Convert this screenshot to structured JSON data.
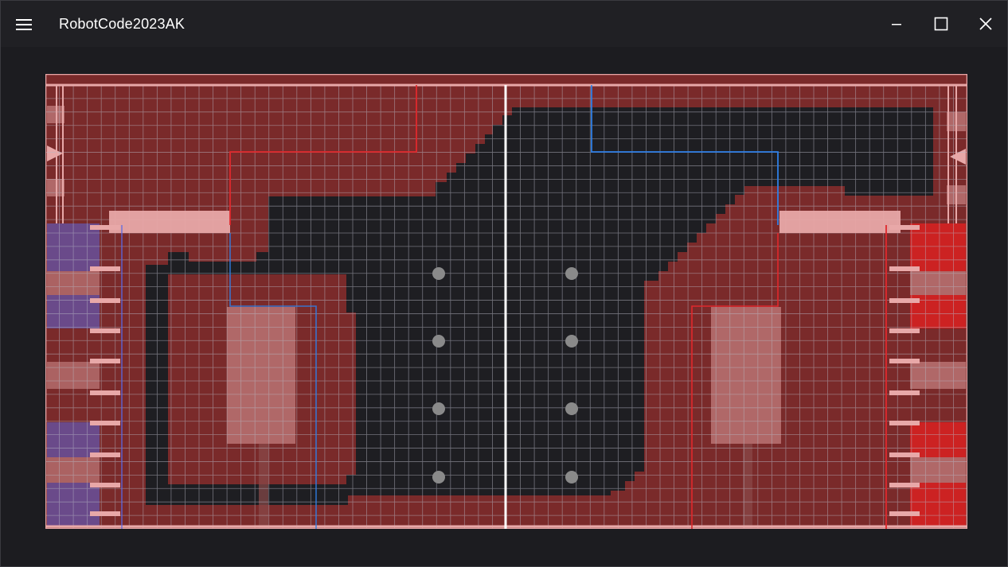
{
  "window": {
    "title": "RobotCode2023AK",
    "controls": {
      "menu_icon": "hamburger-icon",
      "minimize_icon": "minimize-icon",
      "maximize_icon": "maximize-icon",
      "close_icon": "close-icon"
    }
  },
  "field": {
    "colors": {
      "background": "#7a2a2a",
      "open_floor": "#1e1e22",
      "grid_line": "#b8b8c4",
      "center_line": "#ffffff",
      "red_path": "#e0282c",
      "blue_path": "#2f7fe6",
      "barrier": "#e8a8a8",
      "blue_alliance": "#6a4a8a",
      "red_alliance": "#cc2222",
      "charge_station": "#b06868",
      "game_piece": "#8a8a8a"
    },
    "grid_size": {
      "cols": 66,
      "rows": 33
    },
    "game_piece_count": 8
  }
}
